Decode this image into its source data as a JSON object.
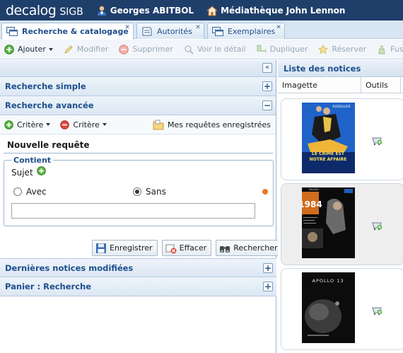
{
  "header": {
    "brand": "decalog",
    "brand_sub": "SIGB",
    "user": "Georges ABITBOL",
    "library": "Médiathèque John Lennon",
    "bg_color": "#1f3f6b"
  },
  "tabs": [
    {
      "label": "Recherche & catalogage",
      "active": true,
      "icon": "catalog-window-icon"
    },
    {
      "label": "Autorités",
      "active": false,
      "icon": "authority-note-icon"
    },
    {
      "label": "Exemplaires",
      "active": false,
      "icon": "copies-window-icon"
    }
  ],
  "toolbar": {
    "add": "Ajouter",
    "edit": "Modifier",
    "delete": "Supprimer",
    "view": "Voir le détail",
    "duplicate": "Dupliquer",
    "reserve": "Réserver",
    "merge": "Fusionner avec"
  },
  "left": {
    "simple_search": "Recherche simple",
    "advanced_search": "Recherche avancée",
    "criteria_add": "Critère",
    "criteria_remove": "Critère",
    "saved_queries": "Mes requêtes enregistrées",
    "new_query": "Nouvelle requête",
    "contains_legend": "Contient",
    "subject_label": "Sujet",
    "with_label": "Avec",
    "without_label": "Sans",
    "selected_option": "Sans",
    "input_value": "",
    "save_btn": "Enregistrer",
    "clear_btn": "Effacer",
    "search_btn": "Rechercher",
    "recent_notices": "Dernières notices modifiées",
    "basket": "Panier : Recherche"
  },
  "right": {
    "title": "Liste des notices",
    "col_thumbnail": "Imagette",
    "col_tools": "Outils",
    "covers": [
      {
        "title_line1": "LE CRIME EST",
        "title_line2": "NOTRE AFFAIRE",
        "top_text": "DUSSOLLIER"
      },
      {
        "title": "1984",
        "top_text": "MAAZEL"
      },
      {
        "title": "APOLLO 13"
      }
    ]
  }
}
